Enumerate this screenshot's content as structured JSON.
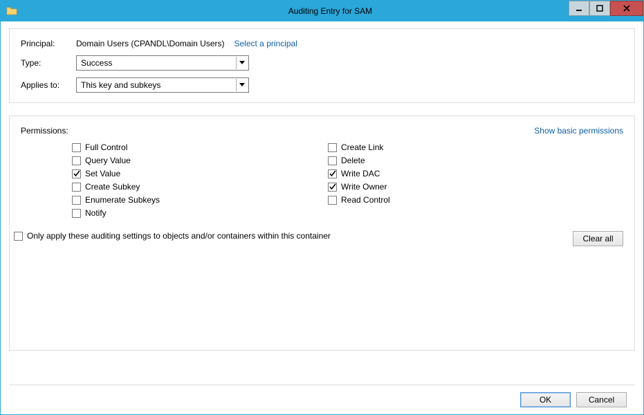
{
  "window": {
    "title": "Auditing Entry for SAM"
  },
  "top": {
    "principalLabel": "Principal:",
    "principalValue": "Domain Users (CPANDL\\Domain Users)",
    "selectPrincipal": "Select a principal",
    "typeLabel": "Type:",
    "typeValue": "Success",
    "appliesLabel": "Applies to:",
    "appliesValue": "This key and subkeys"
  },
  "permissions": {
    "header": "Permissions:",
    "showBasic": "Show basic permissions",
    "left": [
      {
        "label": "Full Control",
        "checked": false
      },
      {
        "label": "Query Value",
        "checked": false
      },
      {
        "label": "Set Value",
        "checked": true
      },
      {
        "label": "Create Subkey",
        "checked": false
      },
      {
        "label": "Enumerate Subkeys",
        "checked": false
      },
      {
        "label": "Notify",
        "checked": false
      }
    ],
    "right": [
      {
        "label": "Create Link",
        "checked": false
      },
      {
        "label": "Delete",
        "checked": false
      },
      {
        "label": "Write DAC",
        "checked": true
      },
      {
        "label": "Write Owner",
        "checked": true
      },
      {
        "label": "Read Control",
        "checked": false
      }
    ],
    "onlyApply": {
      "label": "Only apply these auditing settings to objects and/or containers within this container",
      "checked": false
    },
    "clearAll": "Clear all"
  },
  "footer": {
    "ok": "OK",
    "cancel": "Cancel"
  }
}
